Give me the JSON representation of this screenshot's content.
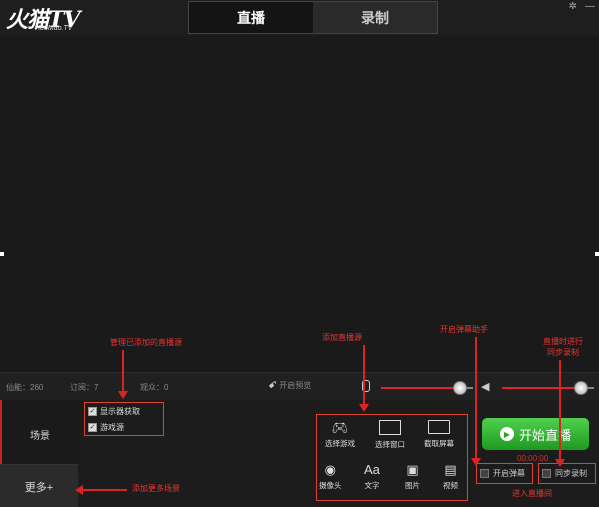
{
  "app": {
    "logo_text": "火猫TV",
    "logo_sub": "HuoMao.TV",
    "tabs": [
      {
        "label": "直播"
      },
      {
        "label": "录制"
      }
    ]
  },
  "status": {
    "xianneng": "仙能：260",
    "subscribe": "订阅：7",
    "viewers": "观众：0",
    "preview_toggle": "开启预览",
    "mic_volume": 0.85,
    "speaker_volume": 0.85
  },
  "scenes": {
    "tab_label": "场景",
    "more_label": "更多+"
  },
  "sources": [
    {
      "label": "显示器获取",
      "checked": true
    },
    {
      "label": "游戏源",
      "checked": true
    }
  ],
  "add_sources": [
    {
      "label": "选择游戏",
      "icon": "gamepad-icon"
    },
    {
      "label": "选择窗口",
      "icon": "window-icon"
    },
    {
      "label": "截取屏幕",
      "icon": "monitor-icon"
    },
    {
      "label": "摄像头",
      "icon": "camera-icon"
    },
    {
      "label": "文字",
      "icon": "text-icon",
      "glyph": "Aa"
    },
    {
      "label": "图片",
      "icon": "image-icon"
    },
    {
      "label": "视频",
      "icon": "film-icon"
    }
  ],
  "controls": {
    "start_label": "开始直播",
    "timer": "00:00:00",
    "danmaku_label": "开启弹幕",
    "sync_record_label": "同步录制"
  },
  "annotations": {
    "manage_sources": "管理已添加的直播源",
    "add_source": "添加直播源",
    "open_danmaku": "开启弹幕助手",
    "sync_record_line1": "直播时进行",
    "sync_record_line2": "同步录制",
    "add_scene": "添加更多场景",
    "enter_room": "进入直播间"
  },
  "colors": {
    "accent": "#d43333",
    "start_button": "#2fb52f"
  }
}
